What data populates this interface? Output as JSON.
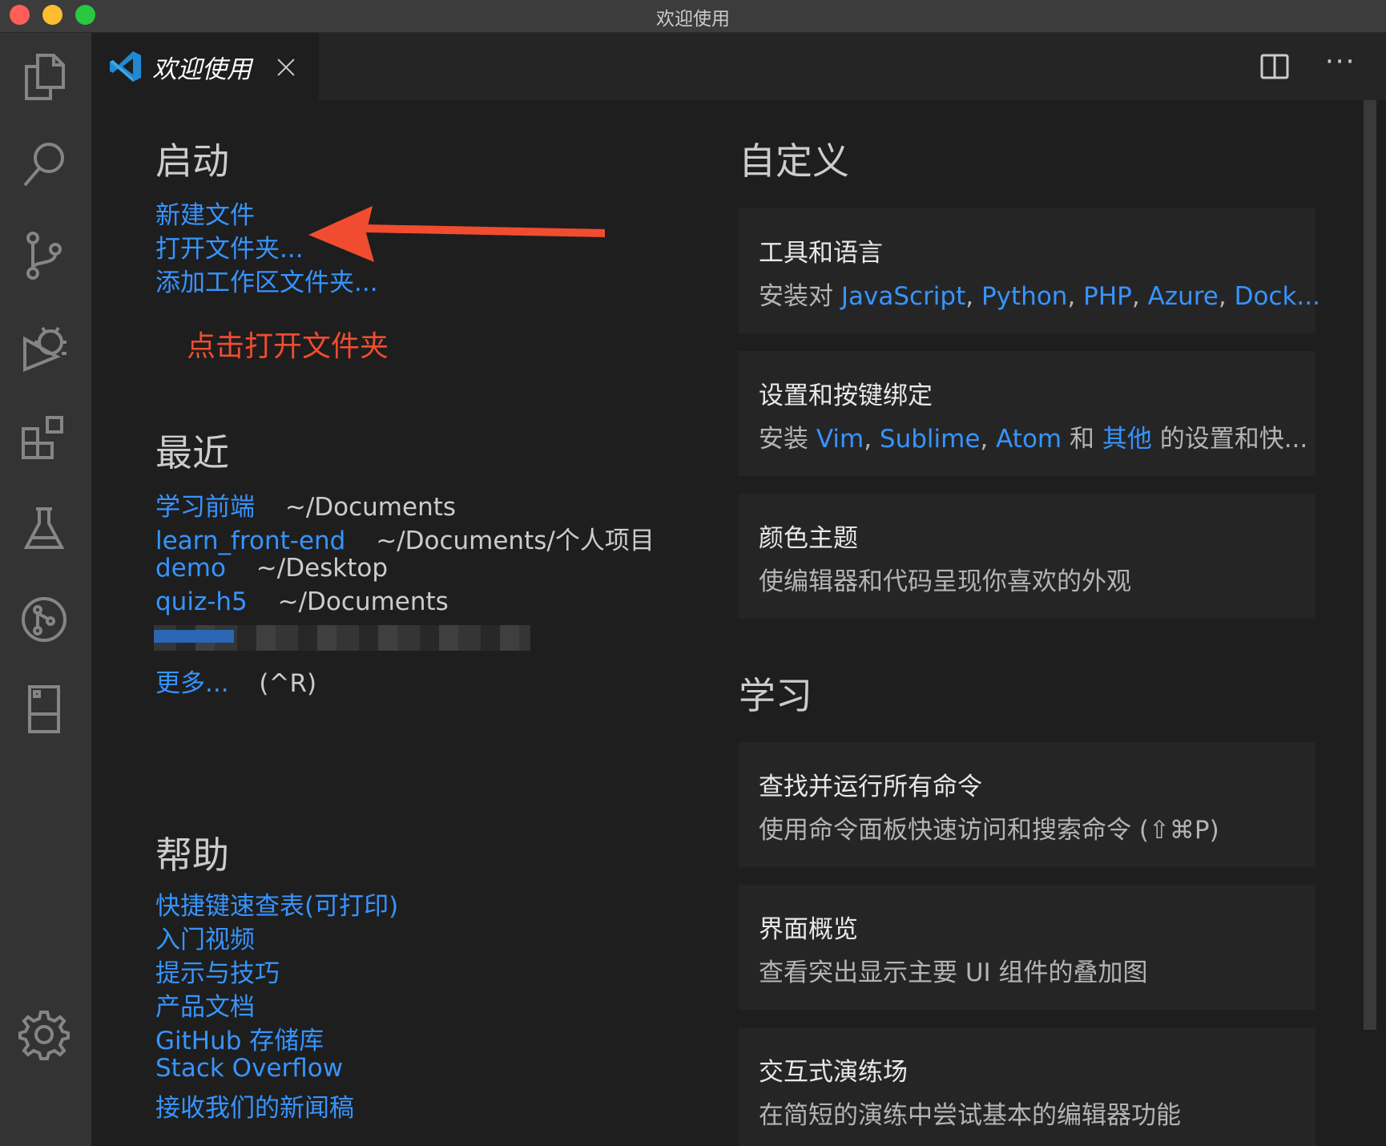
{
  "window": {
    "title": "欢迎使用"
  },
  "tab": {
    "label": "欢迎使用"
  },
  "icons": {
    "explorer": "files-icon",
    "search": "search-icon",
    "scm": "source-control-icon",
    "debug": "debug-icon",
    "extensions": "extensions-icon",
    "test": "beaker-icon",
    "gitlens": "git-graph-icon",
    "remote": "remote-icon",
    "settings": "gear-icon"
  },
  "start": {
    "heading": "启动",
    "new_file": "新建文件",
    "open_folder": "打开文件夹...",
    "add_workspace_folder": "添加工作区文件夹..."
  },
  "annotation": {
    "text": "点击打开文件夹"
  },
  "recent": {
    "heading": "最近",
    "items": [
      {
        "name": "学习前端",
        "path": "~/Documents"
      },
      {
        "name": "learn_front-end",
        "path": "~/Documents/个人项目"
      },
      {
        "name": "demo",
        "path": "~/Desktop"
      },
      {
        "name": "quiz-h5",
        "path": "~/Documents"
      }
    ],
    "more_label": "更多...",
    "more_shortcut": "(^R)"
  },
  "help": {
    "heading": "帮助",
    "links": [
      "快捷键速查表(可打印)",
      "入门视频",
      "提示与技巧",
      "产品文档",
      "GitHub 存储库",
      "Stack Overflow",
      "接收我们的新闻稿"
    ]
  },
  "customize": {
    "heading": "自定义",
    "tools": {
      "title": "工具和语言",
      "prefix": "安装对 ",
      "langs": [
        "JavaScript",
        "Python",
        "PHP",
        "Azure",
        "Dock..."
      ]
    },
    "keymaps": {
      "title": "设置和按键绑定",
      "prefix": "安装 ",
      "items": [
        "Vim",
        "Sublime",
        "Atom"
      ],
      "and": " 和 ",
      "others": "其他",
      "suffix": " 的设置和快..."
    },
    "theme": {
      "title": "颜色主题",
      "desc": "使编辑器和代码呈现你喜欢的外观"
    }
  },
  "learn": {
    "heading": "学习",
    "commands": {
      "title": "查找并运行所有命令",
      "desc": "使用命令面板快速访问和搜索命令 (⇧⌘P)"
    },
    "overview": {
      "title": "界面概览",
      "desc": "查看突出显示主要 UI 组件的叠加图"
    },
    "playground": {
      "title": "交互式演练场",
      "desc": "在简短的演练中尝试基本的编辑器功能"
    }
  },
  "colors": {
    "link": "#3794ff",
    "annotation": "#f14c2f",
    "background": "#1e1e1e"
  }
}
